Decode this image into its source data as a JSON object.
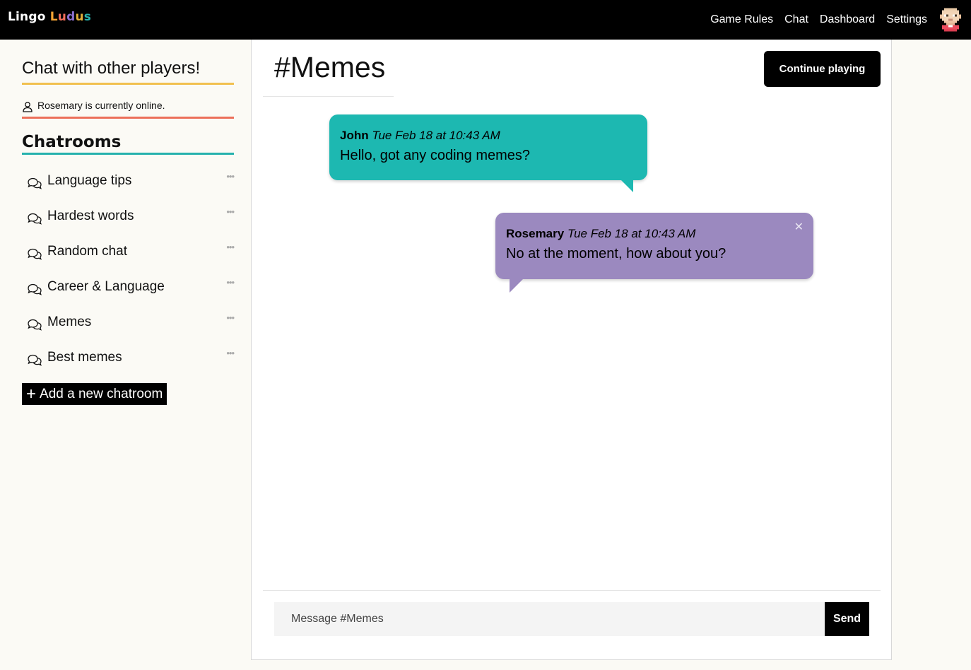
{
  "brand": {
    "part1": "Lingo",
    "part2_letters": [
      "L",
      "u",
      "d",
      "u",
      "s"
    ],
    "part2_colors": [
      "#f6a534",
      "#f16f5c",
      "#8b6fce",
      "#e2b03a",
      "#26b0ac"
    ]
  },
  "nav": {
    "items": [
      {
        "label": "Game Rules"
      },
      {
        "label": "Chat"
      },
      {
        "label": "Dashboard"
      },
      {
        "label": "Settings"
      }
    ]
  },
  "sidebar": {
    "title": "Chat with other players!",
    "online_status": "Rosemary is currently online.",
    "rooms_title": "Chatrooms",
    "rooms": [
      {
        "label": "Language tips",
        "more": "•••"
      },
      {
        "label": "Hardest words",
        "more": "•••"
      },
      {
        "label": "Random chat",
        "more": "•••"
      },
      {
        "label": "Career & Language",
        "more": "•••"
      },
      {
        "label": "Memes",
        "more": "•••"
      },
      {
        "label": "Best memes",
        "more": "•••"
      }
    ],
    "add_room_label": "Add a new chatroom"
  },
  "main": {
    "room_title": "#Memes",
    "continue_label": "Continue playing",
    "messages": [
      {
        "author": "John",
        "time": "Tue Feb 18 at 10:43 AM",
        "text": "Hello, got any coding memes?",
        "color": "#1db8b1"
      },
      {
        "author": "Rosemary",
        "time": "Tue Feb 18 at 10:43 AM",
        "text": "No at the moment, how about you?",
        "color": "#9b89bf"
      }
    ],
    "input_placeholder": "Message #Memes",
    "send_label": "Send"
  }
}
